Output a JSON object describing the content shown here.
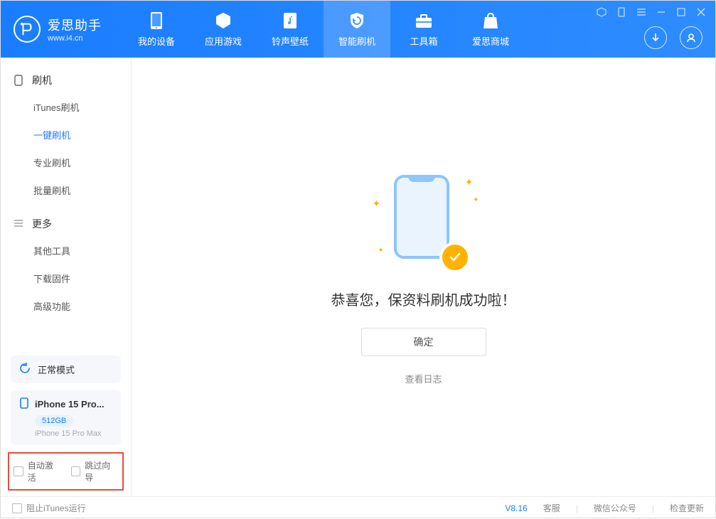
{
  "app": {
    "name": "爱思助手",
    "url": "www.i4.cn"
  },
  "nav": {
    "items": [
      {
        "label": "我的设备"
      },
      {
        "label": "应用游戏"
      },
      {
        "label": "铃声壁纸"
      },
      {
        "label": "智能刷机"
      },
      {
        "label": "工具箱"
      },
      {
        "label": "爱思商城"
      }
    ]
  },
  "sidebar": {
    "group1": {
      "title": "刷机",
      "items": [
        "iTunes刷机",
        "一键刷机",
        "专业刷机",
        "批量刷机"
      ]
    },
    "group2": {
      "title": "更多",
      "items": [
        "其他工具",
        "下载固件",
        "高级功能"
      ]
    }
  },
  "mode": {
    "label": "正常模式"
  },
  "device": {
    "name": "iPhone 15 Pro...",
    "storage": "512GB",
    "model": "iPhone 15 Pro Max"
  },
  "checkboxes": {
    "auto_activate": "自动激活",
    "skip_wizard": "跳过向导"
  },
  "main": {
    "success_text": "恭喜您，保资料刷机成功啦！",
    "ok_button": "确定",
    "view_log": "查看日志"
  },
  "footer": {
    "block_itunes": "阻止iTunes运行",
    "version": "V8.16",
    "links": [
      "客服",
      "微信公众号",
      "检查更新"
    ]
  }
}
